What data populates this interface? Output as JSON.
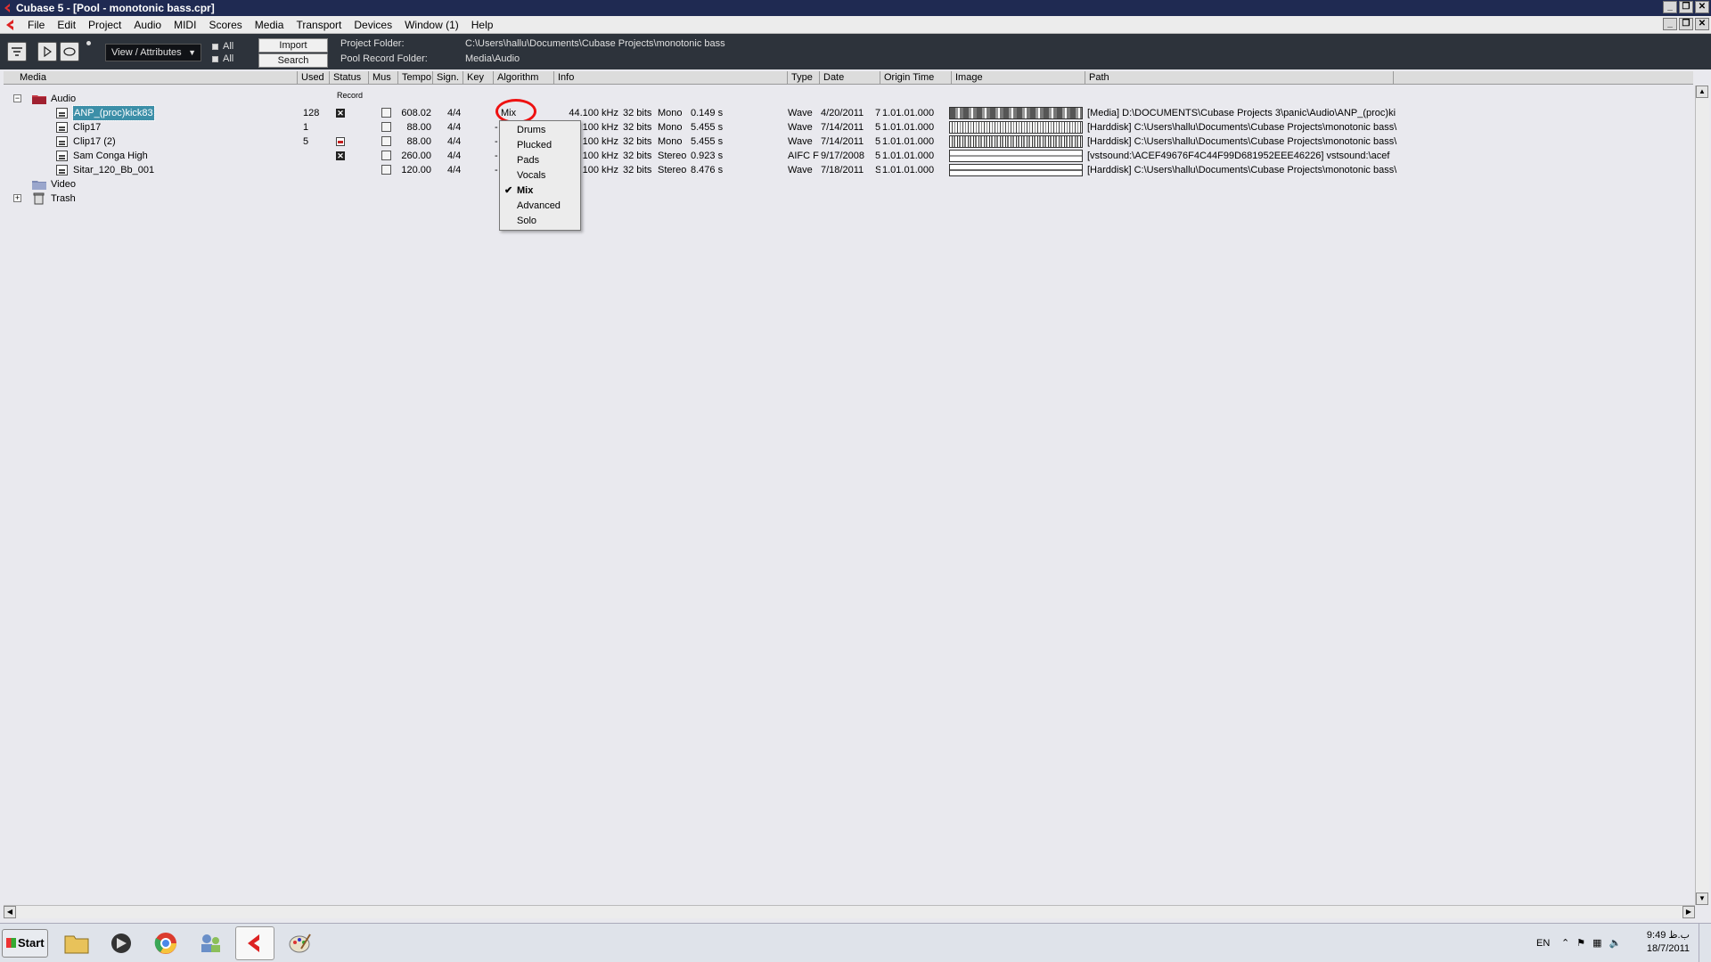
{
  "window": {
    "title": "Cubase 5 - [Pool - monotonic bass.cpr]",
    "controls": [
      "_",
      "❐",
      "✕"
    ]
  },
  "menu": [
    "File",
    "Edit",
    "Project",
    "Audio",
    "MIDI",
    "Scores",
    "Media",
    "Transport",
    "Devices",
    "Window (1)",
    "Help"
  ],
  "toolbar": {
    "view_select": "View / Attributes",
    "all_label_1": "All",
    "all_label_2": "All",
    "import_label": "Import",
    "search_label": "Search",
    "project_folder_label": "Project Folder:",
    "project_folder_value": "C:\\Users\\hallu\\Documents\\Cubase Projects\\monotonic bass",
    "pool_record_label": "Pool Record Folder:",
    "pool_record_value": "Media\\Audio"
  },
  "columns": [
    "Media",
    "Used",
    "Status",
    "Mus",
    "Tempo",
    "Sign.",
    "Key",
    "Algorithm",
    "Info",
    "Type",
    "Date",
    "Origin Time",
    "Image",
    "Path"
  ],
  "status_header_sub": "Record",
  "tree": {
    "audio_folder": "Audio",
    "video_folder": "Video",
    "trash_folder": "Trash"
  },
  "rows": [
    {
      "name": "ANP_(proc)kick83",
      "used": "128",
      "status": "x",
      "tempo": "608.02",
      "sign": "4/4",
      "algorithm": "Mix",
      "info_rate": "44.100 kHz",
      "info_bits": "32 bits",
      "info_ch": "Mono",
      "info_len": "0.149 s",
      "type": "Wave",
      "date": "4/20/2011",
      "date_tail": "7",
      "origin": "1.01.01.000",
      "path": "[Media] D:\\DOCUMENTS\\Cubase Projects 3\\panic\\Audio\\ANP_(proc)ki"
    },
    {
      "name": "Clip17",
      "used": "1",
      "status": "",
      "tempo": "88.00",
      "sign": "4/4",
      "algorithm": "-",
      "info_rate": "100 kHz",
      "info_bits": "32 bits",
      "info_ch": "Mono",
      "info_len": "5.455 s",
      "type": "Wave",
      "date": "7/14/2011",
      "date_tail": "5",
      "origin": "1.01.01.000",
      "path": "[Harddisk] C:\\Users\\hallu\\Documents\\Cubase Projects\\monotonic bass\\"
    },
    {
      "name": "Clip17 (2)",
      "used": "5",
      "status": "rec",
      "tempo": "88.00",
      "sign": "4/4",
      "algorithm": "-",
      "info_rate": "100 kHz",
      "info_bits": "32 bits",
      "info_ch": "Mono",
      "info_len": "5.455 s",
      "type": "Wave",
      "date": "7/14/2011",
      "date_tail": "5",
      "origin": "1.01.01.000",
      "path": "[Harddisk] C:\\Users\\hallu\\Documents\\Cubase Projects\\monotonic bass\\"
    },
    {
      "name": "Sam Conga High",
      "used": "",
      "status": "x",
      "tempo": "260.00",
      "sign": "4/4",
      "algorithm": "-",
      "info_rate": "100 kHz",
      "info_bits": "32 bits",
      "info_ch": "Stereo",
      "info_len": "0.923 s",
      "type": "AIFC F",
      "date": "9/17/2008",
      "date_tail": "5",
      "origin": "1.01.01.000",
      "path": "[vstsound:\\ACEF49676F4C44F99D681952EEE46226] vstsound:\\acef"
    },
    {
      "name": "Sitar_120_Bb_001",
      "used": "",
      "status": "",
      "tempo": "120.00",
      "sign": "4/4",
      "algorithm": "-",
      "info_rate": "100 kHz",
      "info_bits": "32 bits",
      "info_ch": "Stereo",
      "info_len": "8.476 s",
      "type": "Wave",
      "date": "7/18/2011",
      "date_tail": "S",
      "origin": "1.01.01.000",
      "path": "[Harddisk] C:\\Users\\hallu\\Documents\\Cubase Projects\\monotonic bass\\"
    }
  ],
  "algorithm_menu": {
    "items": [
      "Drums",
      "Plucked",
      "Pads",
      "Vocals",
      "Mix",
      "Advanced",
      "Solo"
    ],
    "checked": "Mix"
  },
  "taskbar": {
    "start_label": "Start",
    "lang": "EN",
    "time": "9:49 ب.ظ",
    "date": "18/7/2011"
  },
  "icons": [
    "cubase-icon",
    "filter-icon",
    "play-icon",
    "loop-icon",
    "folder-icon",
    "trash-icon",
    "audio-file-icon"
  ],
  "colors": {
    "titlebar": "#1f2a52",
    "toolbar": "#2d333b",
    "selection": "#3c8fa8",
    "highlight": "#e11111",
    "record": "#c41e1e"
  }
}
